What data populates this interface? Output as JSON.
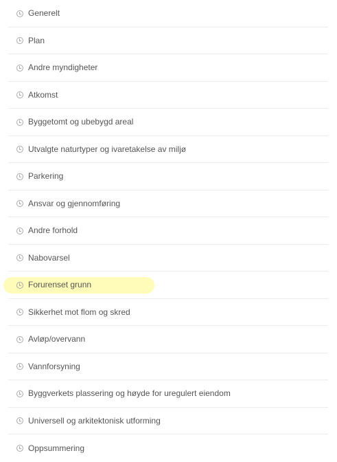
{
  "nav": {
    "items": [
      {
        "label": "Generelt",
        "icon": "clock-icon"
      },
      {
        "label": "Plan",
        "icon": "clock-icon"
      },
      {
        "label": "Andre myndigheter",
        "icon": "clock-icon"
      },
      {
        "label": "Atkomst",
        "icon": "clock-icon"
      },
      {
        "label": "Byggetomt og ubebygd areal",
        "icon": "clock-icon"
      },
      {
        "label": "Utvalgte naturtyper og ivaretakelse av miljø",
        "icon": "clock-icon"
      },
      {
        "label": "Parkering",
        "icon": "clock-icon"
      },
      {
        "label": "Ansvar og gjennomføring",
        "icon": "clock-icon"
      },
      {
        "label": "Andre forhold",
        "icon": "clock-icon"
      },
      {
        "label": "Nabovarsel",
        "icon": "clock-icon"
      },
      {
        "label": "Forurenset grunn",
        "icon": "clock-icon",
        "highlighted": true
      },
      {
        "label": "Sikkerhet mot flom og skred",
        "icon": "clock-icon"
      },
      {
        "label": "Avløp/overvann",
        "icon": "clock-icon"
      },
      {
        "label": "Vannforsyning",
        "icon": "clock-icon"
      },
      {
        "label": "Byggverkets plassering og høyde for uregulert eiendom",
        "icon": "clock-icon"
      },
      {
        "label": "Universell og arkitektonisk utforming",
        "icon": "clock-icon"
      },
      {
        "label": "Oppsummering",
        "icon": "clock-icon"
      }
    ]
  },
  "colors": {
    "text": "#555555",
    "icon": "#a9a9a9",
    "divider": "#ececec",
    "highlight": "#fffbb8"
  }
}
